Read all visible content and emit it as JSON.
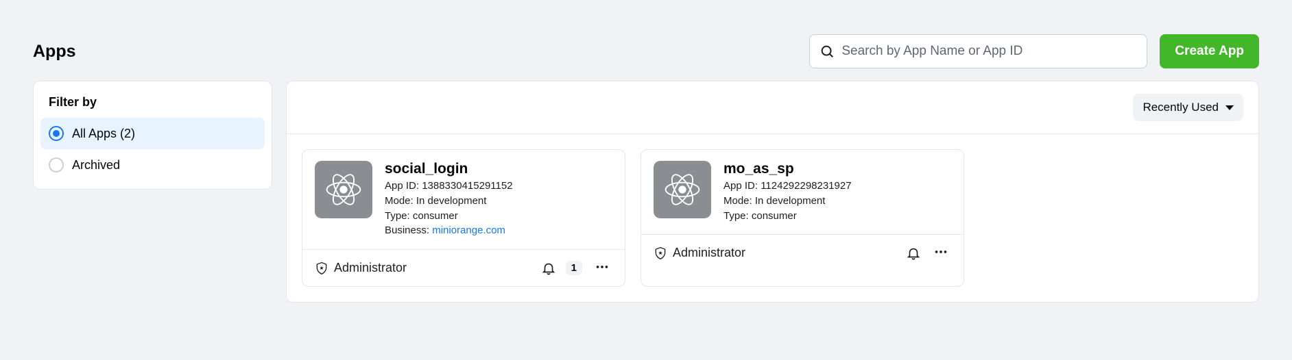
{
  "header": {
    "title": "Apps",
    "search_placeholder": "Search by App Name or App ID",
    "create_label": "Create App",
    "sort_label": "Recently Used"
  },
  "filter": {
    "title": "Filter by",
    "items": [
      {
        "label": "All Apps (2)",
        "active": true
      },
      {
        "label": "Archived",
        "active": false
      }
    ]
  },
  "apps": [
    {
      "name": "social_login",
      "app_id_line": "App ID: 1388330415291152",
      "mode_line": "Mode: In development",
      "type_line": "Type: consumer",
      "business_prefix": "Business: ",
      "business_link": "miniorange.com",
      "role": "Administrator",
      "notifications": "1"
    },
    {
      "name": "mo_as_sp",
      "app_id_line": "App ID: 1124292298231927",
      "mode_line": "Mode: In development",
      "type_line": "Type: consumer",
      "business_prefix": "",
      "business_link": "",
      "role": "Administrator",
      "notifications": ""
    }
  ]
}
